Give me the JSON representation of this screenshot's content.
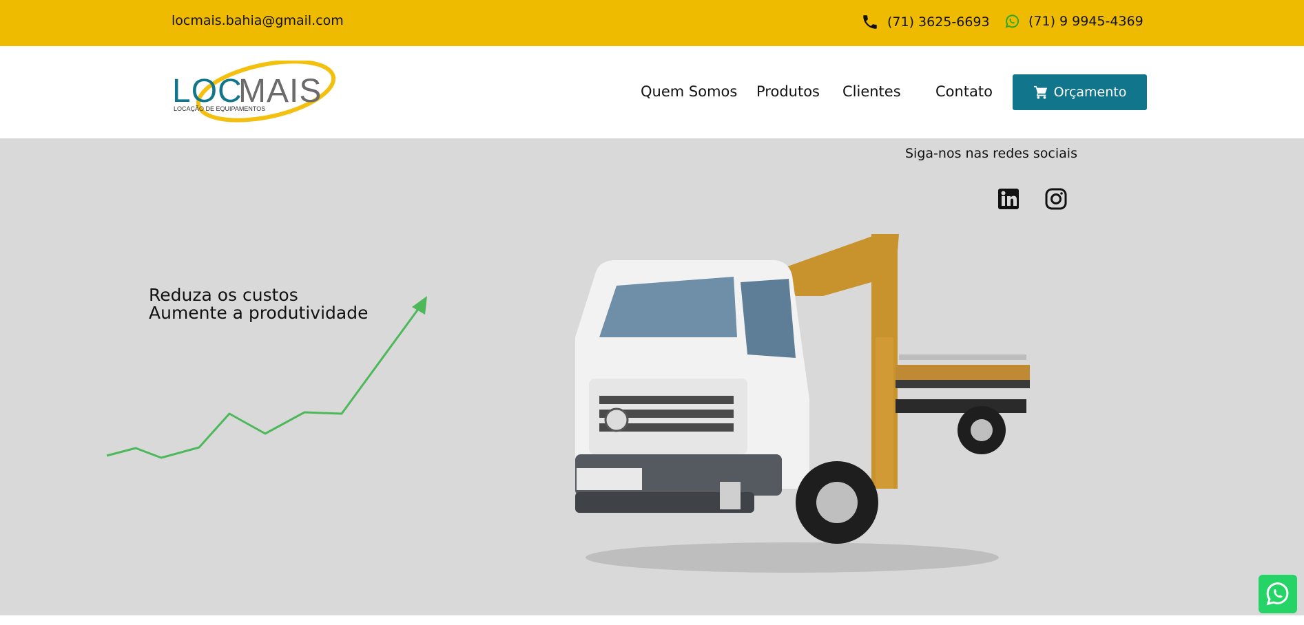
{
  "topbar": {
    "email": "locmais.bahia@gmail.com",
    "phone": "(71) 3625-6693",
    "whatsapp": "(71) 9 9945-4369",
    "bg_color": "#EFBB00"
  },
  "logo": {
    "brand": "LOCMAIS",
    "tagline": "LOCAÇÃO DE EQUIPAMENTOS"
  },
  "nav": {
    "items": [
      "Quem Somos",
      "Produtos",
      "Clientes",
      "Contato"
    ],
    "cta_label": "Orçamento",
    "cta_color": "#11768B"
  },
  "hero": {
    "follow_text": "Siga-nos nas redes sociais",
    "headline_1": "Reduza os custos",
    "headline_2": "Aumente a produtividade",
    "bg_color": "#D9D9D9",
    "trend_color": "#4CB85A",
    "social_icons": [
      "linkedin-icon",
      "instagram-icon"
    ]
  },
  "floating": {
    "icon": "whatsapp-icon",
    "color": "#25D366"
  }
}
